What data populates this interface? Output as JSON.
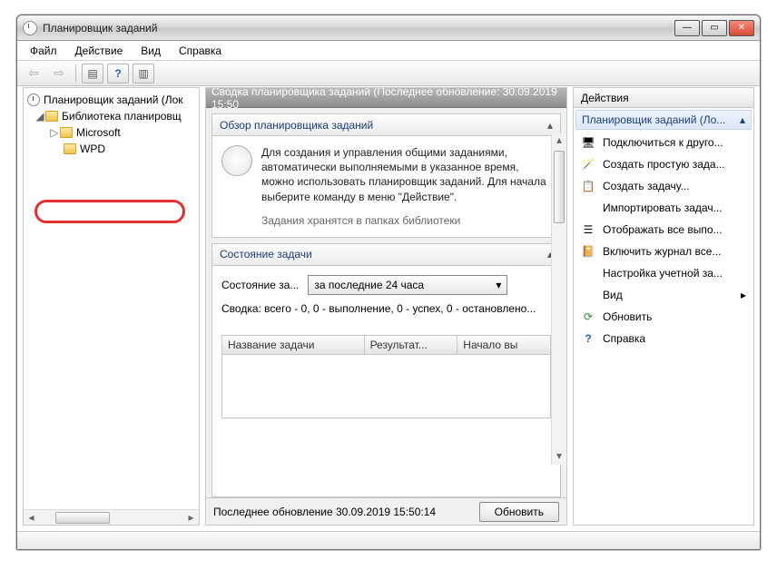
{
  "window": {
    "title": "Планировщик заданий"
  },
  "menu": {
    "file": "Файл",
    "action": "Действие",
    "view": "Вид",
    "help": "Справка"
  },
  "tree": {
    "root": "Планировщик заданий (Лок",
    "lib": "Библиотека планировщ",
    "ms": "Microsoft",
    "wpd": "WPD"
  },
  "mid": {
    "header": "Сводка планировщика заданий (Последнее обновление: 30.09.2019 15:50",
    "overview_title": "Обзор планировщика заданий",
    "overview_text": "Для создания и управления общими заданиями, автоматически выполняемыми в указанное время, можно использовать планировщик заданий. Для начала выберите команду в меню \"Действие\".",
    "overview_trunc": "Задания хранятся в папках библиотеки",
    "state_title": "Состояние задачи",
    "state_label": "Состояние за...",
    "state_period": "за последние 24 часа",
    "summary": "Сводка: всего - 0, 0 - выполнение, 0 - успех, 0 - остановлено...",
    "col_name": "Название задачи",
    "col_result": "Результат...",
    "col_start": "Начало вы",
    "footer_text": "Последнее обновление 30.09.2019 15:50:14",
    "refresh_btn": "Обновить"
  },
  "actions": {
    "header": "Действия",
    "subheader": "Планировщик заданий (Ло...",
    "items": [
      "Подключиться к друго...",
      "Создать простую зада...",
      "Создать задачу...",
      "Импортировать задач...",
      "Отображать все выпо...",
      "Включить журнал все...",
      "Настройка учетной за...",
      "Вид",
      "Обновить",
      "Справка"
    ]
  }
}
